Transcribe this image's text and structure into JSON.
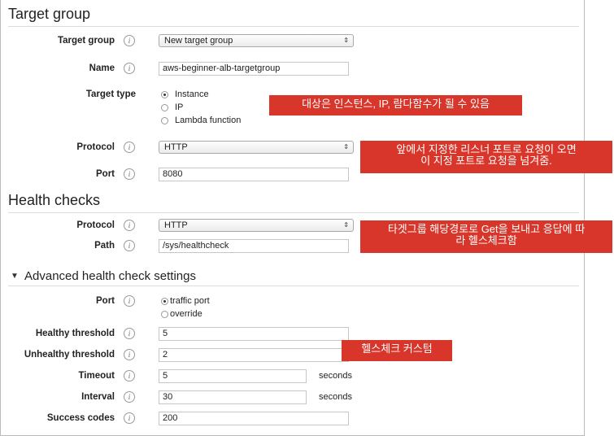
{
  "target_group_section": {
    "title": "Target group",
    "target_group_label": "Target group",
    "target_group_value": "New target group",
    "name_label": "Name",
    "name_value": "aws-beginner-alb-targetgroup",
    "target_type_label": "Target type",
    "target_type_options": [
      "Instance",
      "IP",
      "Lambda function"
    ],
    "target_type_selected": "Instance",
    "protocol_label": "Protocol",
    "protocol_value": "HTTP",
    "port_label": "Port",
    "port_value": "8080"
  },
  "health_checks_section": {
    "title": "Health checks",
    "protocol_label": "Protocol",
    "protocol_value": "HTTP",
    "path_label": "Path",
    "path_value": "/sys/healthcheck"
  },
  "advanced_section": {
    "title": "Advanced health check settings",
    "port_label": "Port",
    "port_options": [
      "traffic port",
      "override"
    ],
    "port_selected": "traffic port",
    "healthy_threshold_label": "Healthy threshold",
    "healthy_threshold_value": "5",
    "unhealthy_threshold_label": "Unhealthy threshold",
    "unhealthy_threshold_value": "2",
    "timeout_label": "Timeout",
    "timeout_value": "5",
    "timeout_unit": "seconds",
    "interval_label": "Interval",
    "interval_value": "30",
    "interval_unit": "seconds",
    "success_codes_label": "Success codes",
    "success_codes_value": "200"
  },
  "annotations": {
    "target_type_note": "대상은 인스턴스, IP, 람다함수가 될 수 있음",
    "port_note_line1": "앞에서 지정한 리스너 포트로 요청이 오면",
    "port_note_line2": "이 지정 포트로 요청을 넘겨줌.",
    "path_note_line1": "타겟그룹 해당경로로 Get을 보내고 응답에 따",
    "path_note_line2": "라 헬스체크함",
    "custom_note": "헬스체크 커스텀"
  },
  "icons": {
    "info": "i",
    "select_arrow": "⇕",
    "triangle": "▼"
  },
  "colors": {
    "annotation_bg": "#d9362b"
  }
}
